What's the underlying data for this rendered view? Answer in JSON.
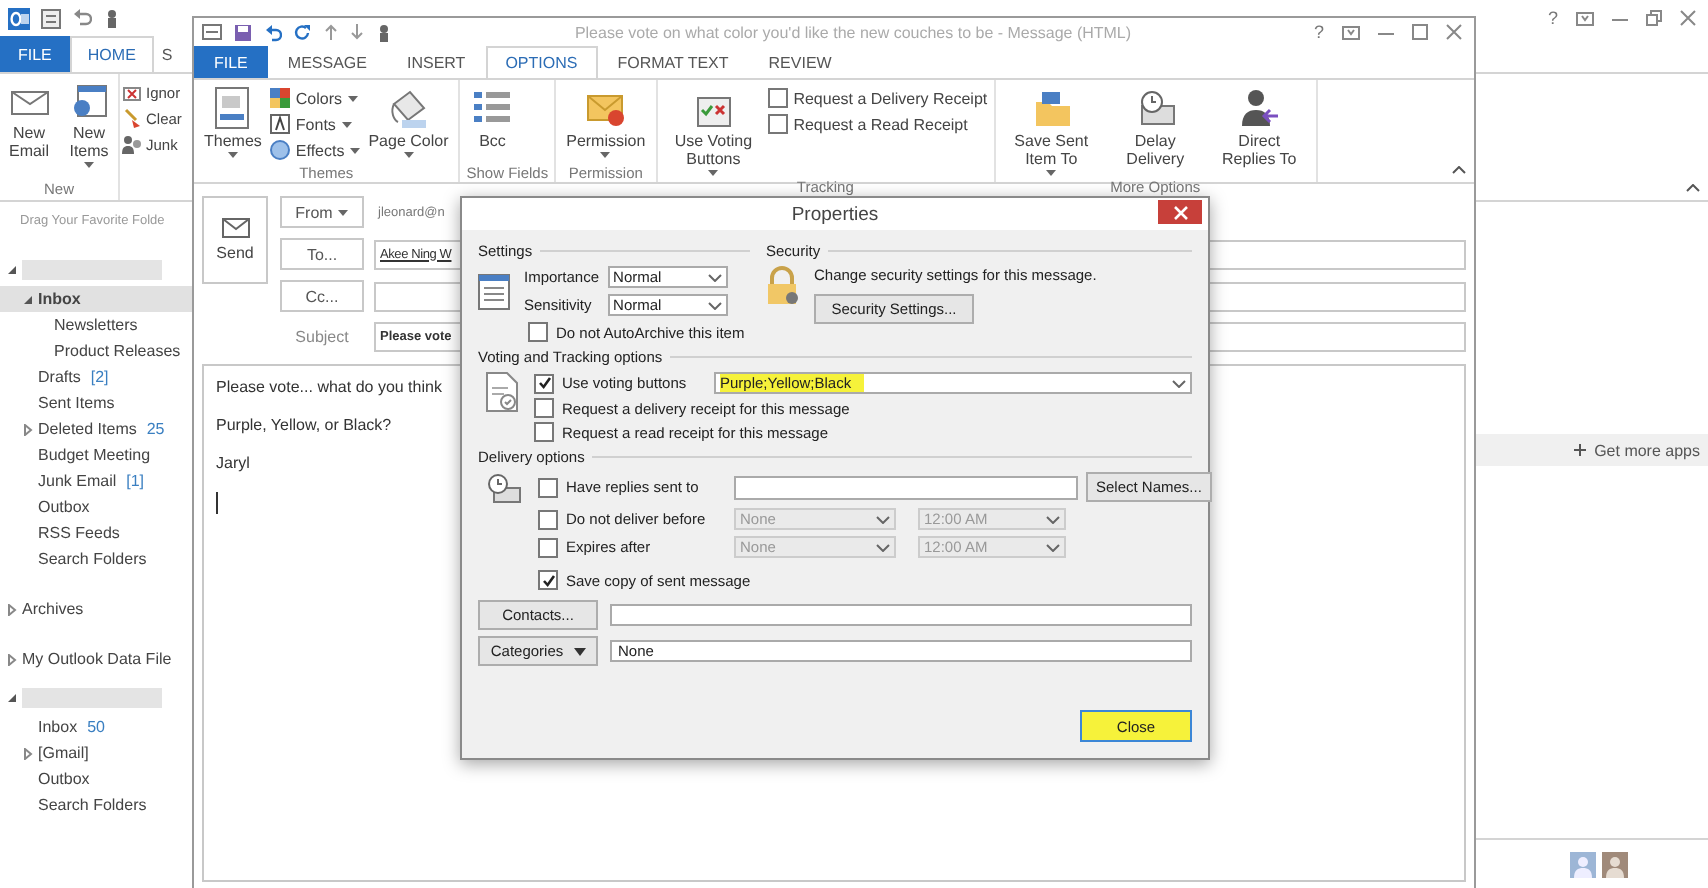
{
  "main_window": {
    "help_button": "?",
    "tabs": [
      {
        "label": "FILE",
        "kind": "file",
        "selected": false
      },
      {
        "label": "HOME",
        "kind": "tab",
        "selected": true
      },
      {
        "label": "S",
        "kind": "tab",
        "selected": false
      }
    ],
    "new_group": {
      "label": "New",
      "buttons": [
        {
          "label": "New Email",
          "dropdown": false
        },
        {
          "label": "New Items",
          "dropdown": true
        }
      ]
    },
    "delete_group": [
      {
        "label": "Ignor"
      },
      {
        "label": "Clear"
      },
      {
        "label": "Junk"
      }
    ],
    "favorites_hint": "Drag Your Favorite Folde",
    "nav_tree": [
      {
        "kind": "account",
        "expanded": true,
        "selected": false,
        "children": [
          {
            "label": "Inbox",
            "expanded": true,
            "selected": true,
            "children": [
              {
                "label": "Newsletters",
                "selected": false
              },
              {
                "label": "Product Releases",
                "selected": false
              }
            ]
          },
          {
            "label": "Drafts",
            "count": "[2]",
            "selected": false
          },
          {
            "label": "Sent Items",
            "selected": false
          },
          {
            "label": "Deleted Items",
            "count": "25",
            "expanded": false,
            "selected": false
          },
          {
            "label": "Budget Meeting",
            "selected": false
          },
          {
            "label": "Junk Email",
            "count": "[1]",
            "selected": false
          },
          {
            "label": "Outbox",
            "selected": false
          },
          {
            "label": "RSS Feeds",
            "selected": false
          },
          {
            "label": "Search Folders",
            "selected": false
          }
        ]
      },
      {
        "kind": "folder",
        "label": "Archives",
        "expanded": false,
        "selected": false
      },
      {
        "kind": "folder",
        "label": "My Outlook Data File",
        "expanded": false,
        "selected": false
      },
      {
        "kind": "account",
        "expanded": true,
        "selected": false,
        "children": [
          {
            "label": "Inbox",
            "count": "50",
            "selected": false
          },
          {
            "label": "[Gmail]",
            "expanded": false,
            "selected": false
          },
          {
            "label": "Outbox",
            "selected": false
          },
          {
            "label": "Search Folders",
            "selected": false
          }
        ]
      }
    ],
    "apps_bar": "Get more apps"
  },
  "message_window": {
    "title": "Please vote on what color you'd like the new couches to be - Message (HTML)",
    "help_button": "?",
    "tabs": [
      {
        "label": "FILE",
        "kind": "file",
        "selected": false
      },
      {
        "label": "MESSAGE",
        "kind": "tab",
        "selected": false
      },
      {
        "label": "INSERT",
        "kind": "tab",
        "selected": false
      },
      {
        "label": "OPTIONS",
        "kind": "tab",
        "selected": true
      },
      {
        "label": "FORMAT TEXT",
        "kind": "tab",
        "selected": false
      },
      {
        "label": "REVIEW",
        "kind": "tab",
        "selected": false
      }
    ],
    "ribbon_groups": [
      {
        "label": "Themes",
        "items": [
          {
            "kind": "large",
            "label": "Themes",
            "dropdown": true
          },
          {
            "kind": "small",
            "label": "Colors",
            "dropdown": true
          },
          {
            "kind": "small",
            "label": "Fonts",
            "dropdown": true
          },
          {
            "kind": "small",
            "label": "Effects",
            "dropdown": true
          },
          {
            "kind": "large",
            "label": "Page Color",
            "dropdown": true
          }
        ]
      },
      {
        "label": "Show Fields",
        "items": [
          {
            "kind": "large",
            "label": "Bcc",
            "dropdown": false
          }
        ]
      },
      {
        "label": "Permission",
        "items": [
          {
            "kind": "large",
            "label": "Permission",
            "dropdown": true
          }
        ]
      },
      {
        "label": "Tracking",
        "items": [
          {
            "kind": "large",
            "label": "Use Voting Buttons",
            "dropdown": true
          },
          {
            "kind": "check",
            "label": "Request a Delivery Receipt",
            "checked": false
          },
          {
            "kind": "check",
            "label": "Request a Read Receipt",
            "checked": false
          }
        ]
      },
      {
        "label": "More Options",
        "items": [
          {
            "kind": "large",
            "label": "Save Sent Item To",
            "dropdown": true
          },
          {
            "kind": "large",
            "label": "Delay Delivery",
            "dropdown": false
          },
          {
            "kind": "large",
            "label": "Direct Replies To",
            "dropdown": false
          }
        ]
      }
    ],
    "compose": {
      "send": "Send",
      "from": "From",
      "to": "To...",
      "cc": "Cc...",
      "subject_label": "Subject",
      "from_value": "jleonard@n",
      "to_value": "Akee Ning W",
      "subject_value": "Please vote",
      "body": [
        "Please vote... what do you think",
        "Purple, Yellow, or Black?",
        "Jaryl"
      ]
    }
  },
  "properties_dialog": {
    "title": "Properties",
    "settings": {
      "label": "Settings",
      "importance_label": "Importance",
      "importance": "Normal",
      "sensitivity_label": "Sensitivity",
      "sensitivity": "Normal",
      "autoarchive": {
        "label": "Do not AutoArchive this item",
        "checked": false
      }
    },
    "security": {
      "label": "Security",
      "text": "Change security settings for this message.",
      "button": "Security Settings..."
    },
    "voting": {
      "label": "Voting and Tracking options",
      "choices": "Purple;Yellow;Black",
      "highlighted": true,
      "options": [
        {
          "label": "Use voting buttons",
          "checked": true
        },
        {
          "label": "Request a delivery receipt for this message",
          "checked": false
        },
        {
          "label": "Request a read receipt for this message",
          "checked": false
        }
      ]
    },
    "delivery": {
      "label": "Delivery options",
      "select_names": "Select Names...",
      "rows": [
        {
          "kind": "field",
          "label": "Have replies sent to",
          "checked": false
        },
        {
          "kind": "schedule",
          "label": "Do not deliver before",
          "checked": false,
          "date": "None",
          "time": "12:00 AM"
        },
        {
          "kind": "schedule",
          "label": "Expires after",
          "checked": false,
          "date": "None",
          "time": "12:00 AM"
        },
        {
          "kind": "plain",
          "label": "Save copy of sent message",
          "checked": true
        }
      ]
    },
    "contacts_button": "Contacts...",
    "categories_button": "Categories",
    "categories_value": "None",
    "close_button": {
      "label": "Close",
      "highlighted": true
    }
  }
}
